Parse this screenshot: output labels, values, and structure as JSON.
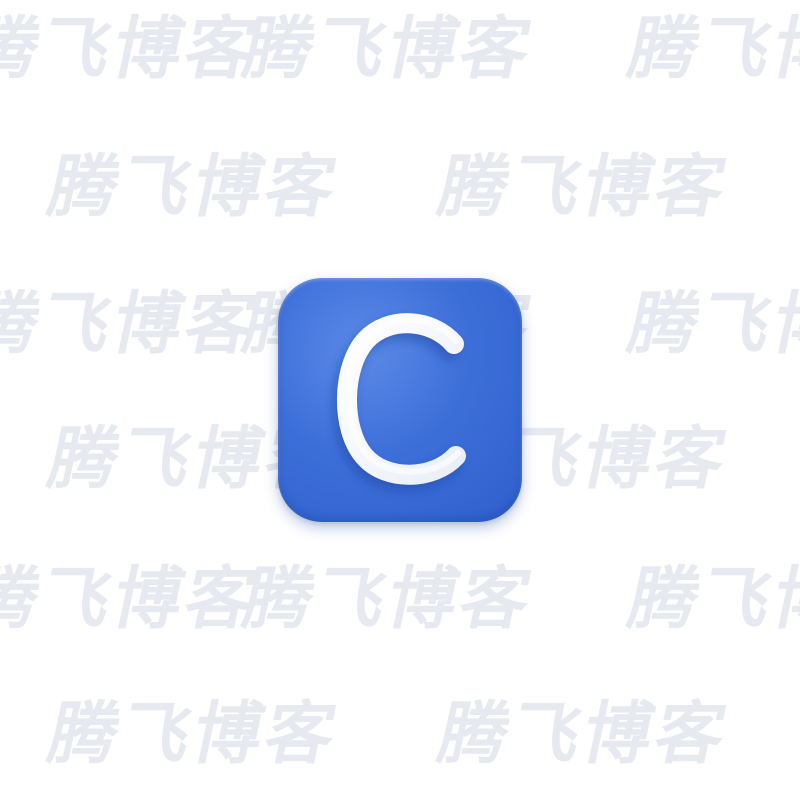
{
  "watermark": {
    "text": "腾飞博客",
    "color": "#e6e9ef"
  },
  "app_icon": {
    "letter": "C",
    "background_color": "#3d6fd9",
    "letter_color": "#ffffff"
  }
}
